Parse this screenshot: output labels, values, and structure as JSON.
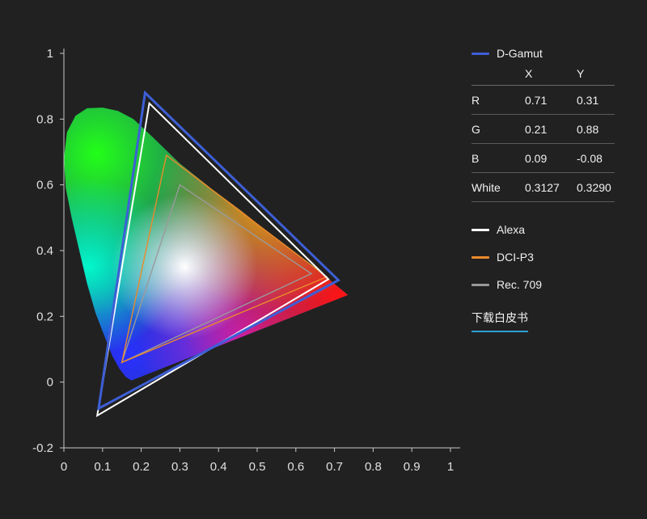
{
  "chart_data": {
    "type": "scatter",
    "title": "",
    "xlabel": "",
    "ylabel": "",
    "xlim": [
      0,
      1
    ],
    "ylim": [
      -0.2,
      1
    ],
    "x_ticks": [
      "0",
      "0.1",
      "0.2",
      "0.3",
      "0.4",
      "0.5",
      "0.6",
      "0.7",
      "0.8",
      "0.9",
      "1"
    ],
    "y_ticks": [
      "1",
      "0.8",
      "0.6",
      "0.4",
      "0.2",
      "0",
      "-0.2"
    ],
    "grid": false,
    "legend_position": "right",
    "background": "CIE 1931 chromaticity horseshoe",
    "series": [
      {
        "name": "D-Gamut",
        "color": "#3d5fd6",
        "points": [
          [
            0.71,
            0.31
          ],
          [
            0.21,
            0.88
          ],
          [
            0.09,
            -0.08
          ]
        ]
      },
      {
        "name": "Alexa",
        "color": "#ffffff",
        "points": [
          [
            0.684,
            0.313
          ],
          [
            0.221,
            0.848
          ],
          [
            0.0861,
            -0.102
          ]
        ]
      },
      {
        "name": "DCI-P3",
        "color": "#e98a2a",
        "points": [
          [
            0.68,
            0.32
          ],
          [
            0.265,
            0.69
          ],
          [
            0.15,
            0.06
          ]
        ]
      },
      {
        "name": "Rec. 709",
        "color": "#9a9a9a",
        "points": [
          [
            0.64,
            0.33
          ],
          [
            0.3,
            0.6
          ],
          [
            0.15,
            0.06
          ]
        ]
      }
    ]
  },
  "panel": {
    "main_legend": "D-Gamut",
    "main_legend_color": "#3d5fd6",
    "headers": [
      "",
      "X",
      "Y"
    ],
    "rows": [
      [
        "R",
        "0.71",
        "0.31"
      ],
      [
        "G",
        "0.21",
        "0.88"
      ],
      [
        "B",
        "0.09",
        "-0.08"
      ],
      [
        "White",
        "0.3127",
        "0.3290"
      ]
    ],
    "legend": [
      {
        "label": "Alexa",
        "color": "#ffffff"
      },
      {
        "label": "DCI-P3",
        "color": "#e98a2a"
      },
      {
        "label": "Rec. 709",
        "color": "#9a9a9a"
      }
    ],
    "download_label": "下载白皮书",
    "download_underline_color": "#2f9fd8"
  }
}
